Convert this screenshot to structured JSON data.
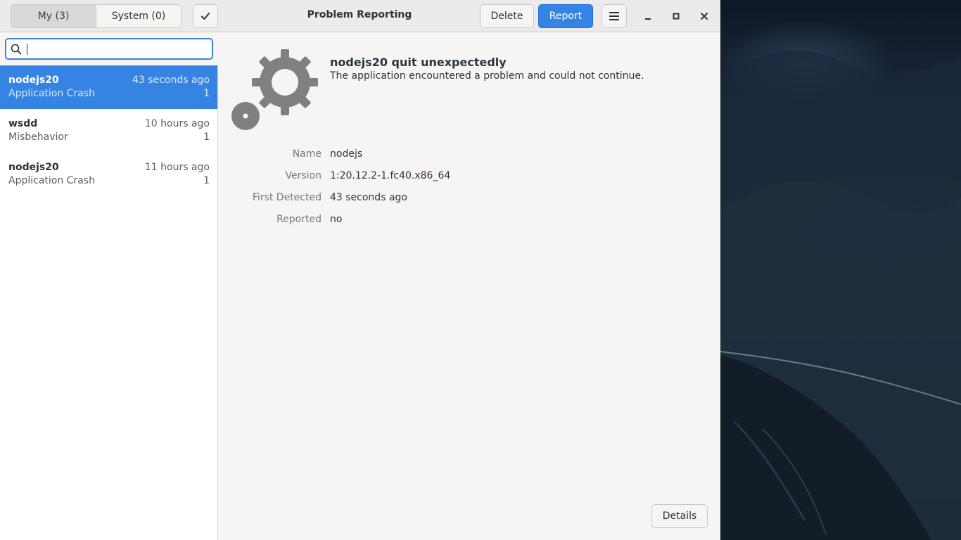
{
  "header": {
    "tabs": [
      {
        "label": "My (3)",
        "selected": true
      },
      {
        "label": "System (0)",
        "selected": false
      }
    ],
    "select_icon": "checkmark-icon",
    "title": "Problem Reporting",
    "delete_label": "Delete",
    "report_label": "Report",
    "menu_icon": "hamburger-menu-icon",
    "window_controls": [
      "minimize-icon",
      "maximize-icon",
      "close-icon"
    ]
  },
  "search": {
    "placeholder": "",
    "value": "",
    "icon": "search-icon"
  },
  "problems": [
    {
      "name": "nodejs20",
      "type": "Application Crash",
      "when": "43 seconds ago",
      "count": "1",
      "selected": true
    },
    {
      "name": "wsdd",
      "type": "Misbehavior",
      "when": "10 hours ago",
      "count": "1",
      "selected": false
    },
    {
      "name": "nodejs20",
      "type": "Application Crash",
      "when": "11 hours ago",
      "count": "1",
      "selected": false
    }
  ],
  "detail": {
    "icon": "gears-icon",
    "heading": "nodejs20 quit unexpectedly",
    "subheading": "The application encountered a problem and could not continue.",
    "fields": [
      {
        "label": "Name",
        "value": "nodejs"
      },
      {
        "label": "Version",
        "value": "1:20.12.2-1.fc40.x86_64"
      },
      {
        "label": "First Detected",
        "value": "43 seconds ago"
      },
      {
        "label": "Reported",
        "value": "no"
      }
    ],
    "details_label": "Details"
  },
  "colors": {
    "accent": "#3584e4",
    "header_bg": "#ebebeb",
    "window_bg": "#f6f5f4",
    "sidebar_bg": "#ffffff"
  }
}
